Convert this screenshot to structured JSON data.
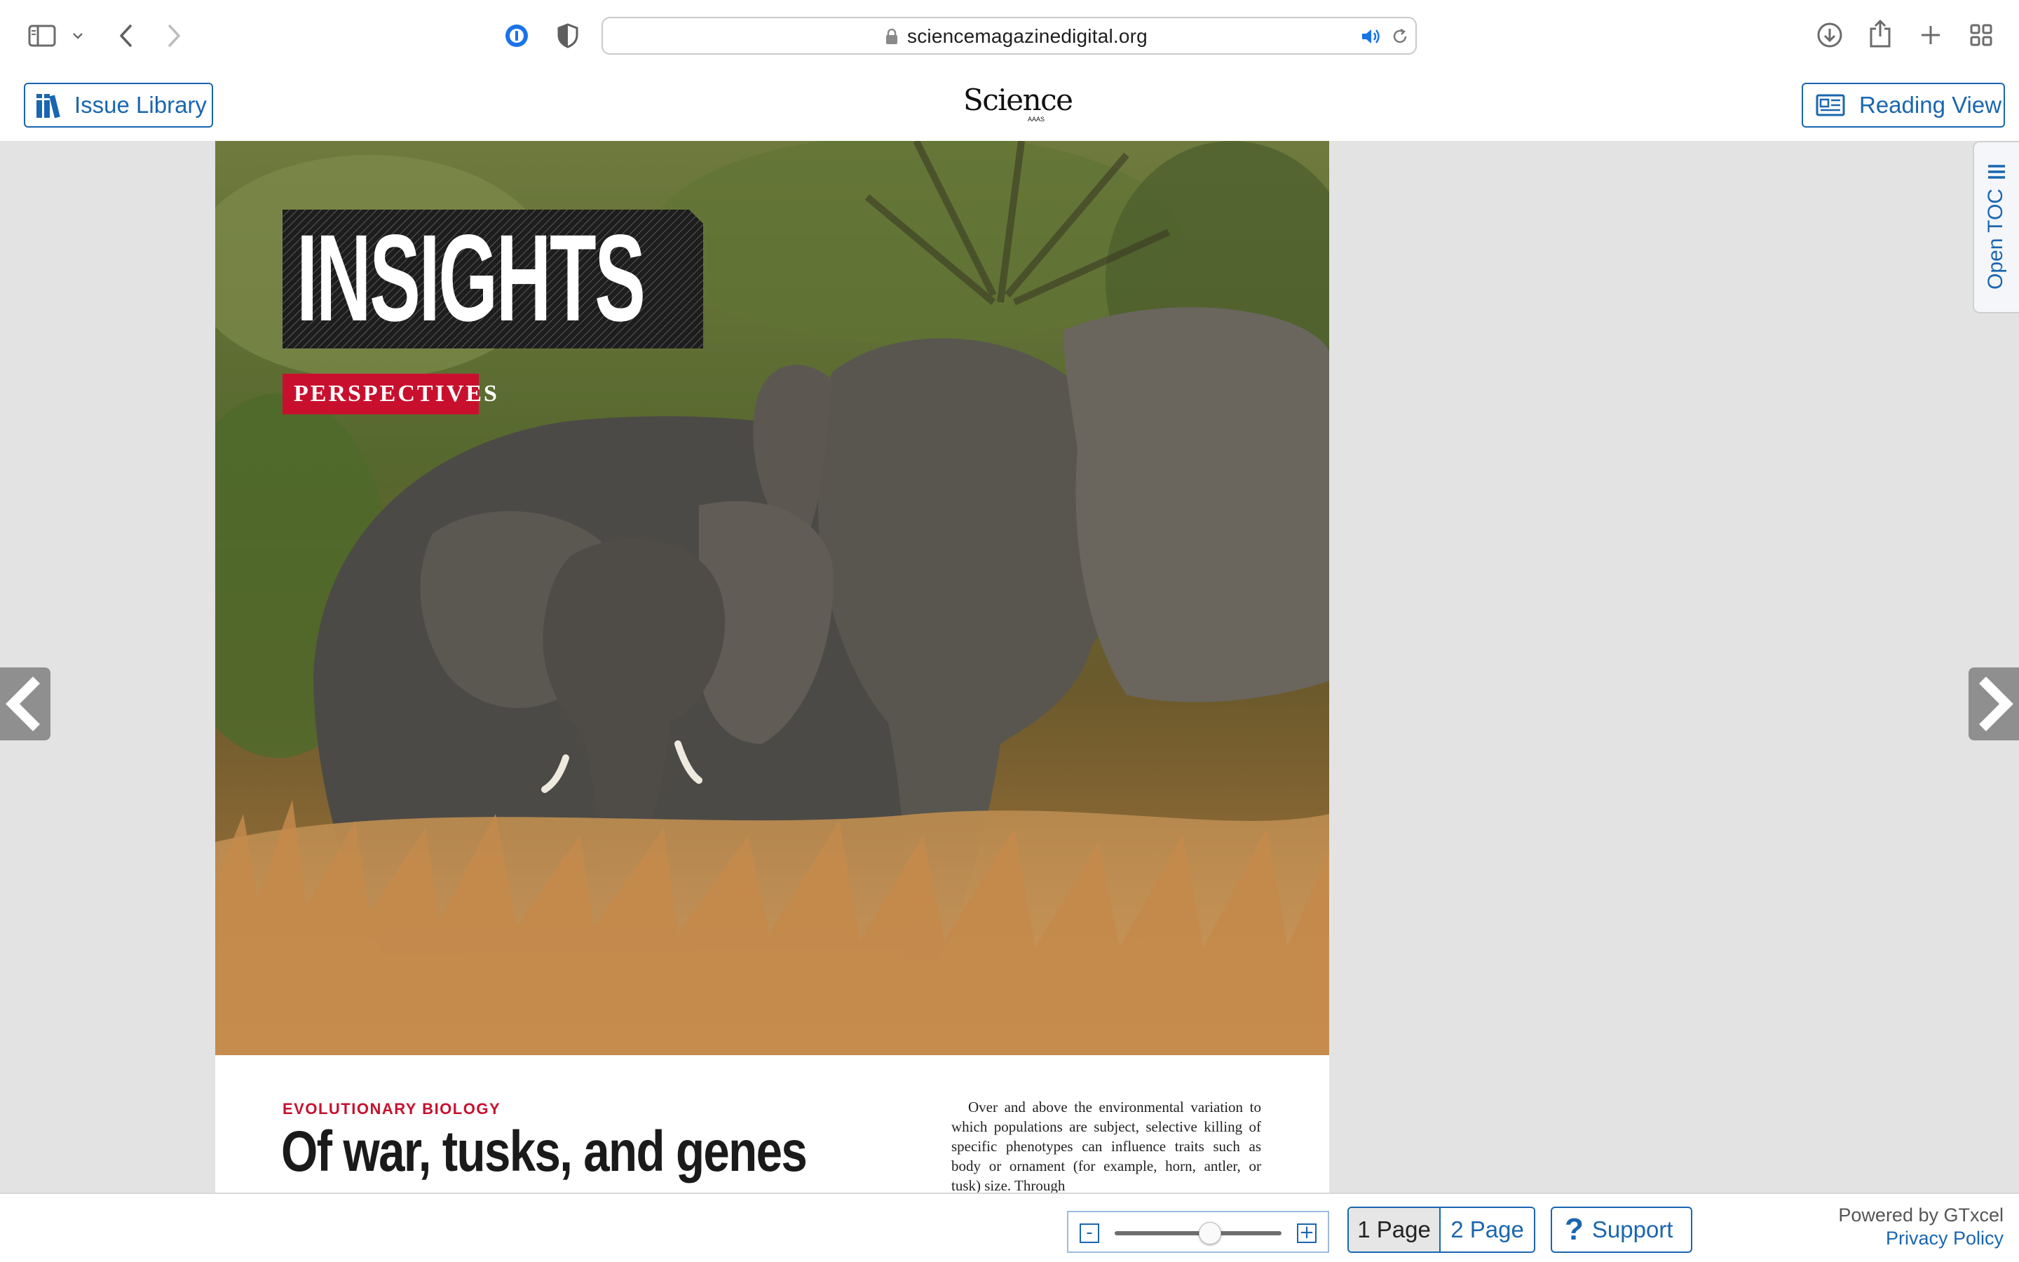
{
  "browser": {
    "url": "sciencemagazinedigital.org"
  },
  "header": {
    "issue_library_label": "Issue Library",
    "logo_text": "Science",
    "logo_subtext": "AAAS",
    "reading_view_label": "Reading View"
  },
  "page": {
    "insights_label": "INSIGHTS",
    "section_label": "PERSPECTIVES",
    "kicker": "EVOLUTIONARY BIOLOGY",
    "headline": "Of war, tusks, and genes",
    "body_excerpt": "Over and above the environmental variation to which populations are subject, selective killing of specific phenotypes can influence traits such as body or ornament (for example, horn, antler, or tusk) size. Through"
  },
  "sidebar": {
    "toc_label": "Open TOC"
  },
  "footer": {
    "zoom": {
      "minus_label": "-",
      "plus_label": "+",
      "level": 0.57
    },
    "page_modes": [
      {
        "label": "1 Page",
        "selected": true
      },
      {
        "label": "2 Page",
        "selected": false
      }
    ],
    "support_label": "Support",
    "powered_by": "Powered by GTxcel",
    "privacy_label": "Privacy Policy"
  },
  "colors": {
    "accent": "#1a66b0",
    "section_red": "#c8102e",
    "reader_background": "#e3e3e3"
  }
}
